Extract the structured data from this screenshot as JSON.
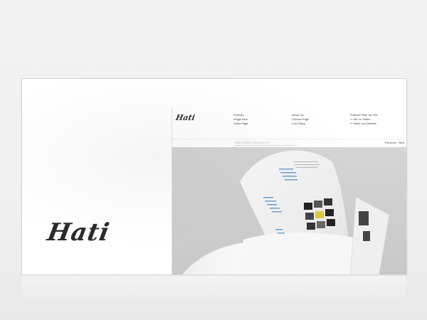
{
  "brand": {
    "logo_text": "Hati",
    "small_logo_text": "Hati"
  },
  "nav": {
    "col1": [
      "Portfolio",
      "Single Item",
      "Video Page"
    ],
    "col2": [
      "About Us",
      "Contact Page",
      "Lost Thing"
    ],
    "col3": [
      "Portfolio Filter by URL",
      "↪ We on Twitter",
      "↪ Watch us Dribbble"
    ]
  },
  "featured": {
    "label": "FEATURED PROJECTS",
    "prev": "Previous",
    "next": "Next"
  },
  "colors": {
    "background": "#f2f2f2",
    "card": "#ffffff",
    "hero": "#cfcfcf",
    "accent": "#3a86c8"
  },
  "icons": {
    "hero_image": "open-brochure-image"
  }
}
